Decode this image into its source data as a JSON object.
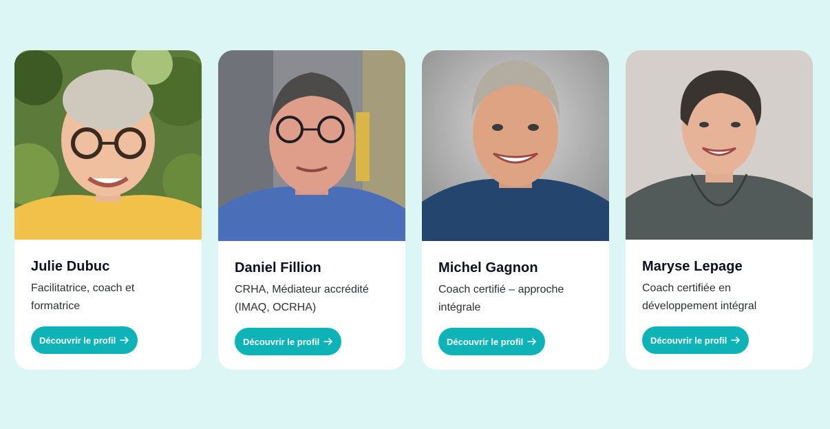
{
  "profiles": [
    {
      "name": "Julie Dubuc",
      "role": "Facilitatrice, coach et formatrice",
      "cta": "Découvrir le profil"
    },
    {
      "name": "Daniel Fillion",
      "role": "CRHA, Médiateur accrédité (IMAQ, OCRHA)",
      "cta": "Découvrir le profil"
    },
    {
      "name": "Michel Gagnon",
      "role": "Coach certifié – approche intégrale",
      "cta": "Découvrir le profil"
    },
    {
      "name": "Maryse Lepage",
      "role": "Coach certifiée en développement intégral",
      "cta": "Découvrir le profil"
    }
  ],
  "colors": {
    "page_background": "#dcf5f5",
    "button": "#0db3b7",
    "card": "#ffffff"
  },
  "icons": {
    "button_icon": "arrow-right-icon"
  }
}
